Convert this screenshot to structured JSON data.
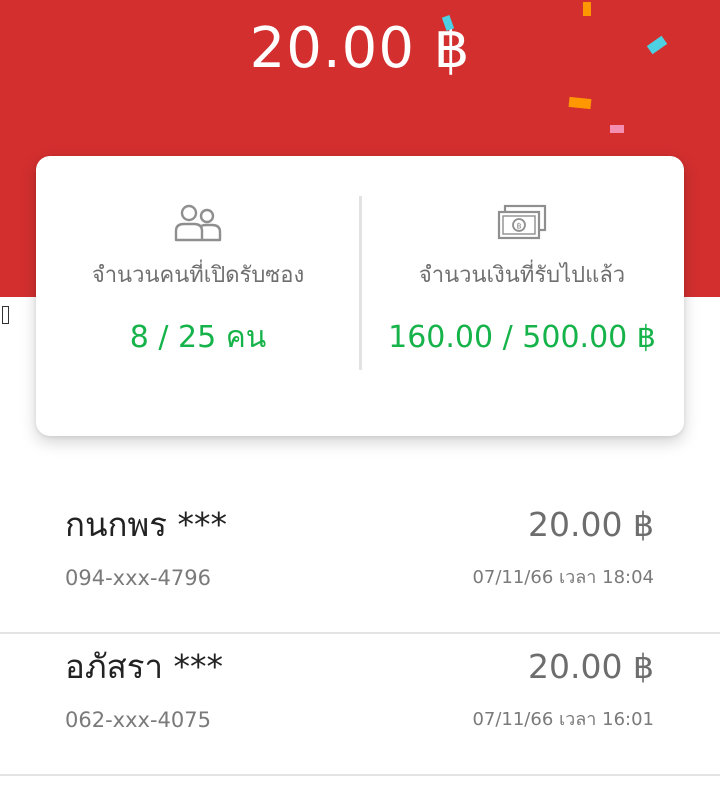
{
  "header": {
    "amount": "20.00 ฿"
  },
  "stats": {
    "opened": {
      "icon": "people-icon",
      "label": "จำนวนคนที่เปิดรับซอง",
      "value": "8 / 25 คน"
    },
    "money": {
      "icon": "banknote-icon",
      "label": "จำนวนเงินที่รับไปแล้ว",
      "value": "160.00 / 500.00 ฿"
    }
  },
  "recipients": [
    {
      "name": "กนกพร ***",
      "amount": "20.00 ฿",
      "phone": "094-xxx-4796",
      "time": "07/11/66 เวลา 18:04"
    },
    {
      "name": "อภัสรา ***",
      "amount": "20.00 ฿",
      "phone": "062-xxx-4075",
      "time": "07/11/66 เวลา 16:01"
    }
  ],
  "colors": {
    "header_red": "#d32f2f",
    "value_green": "#16b34a",
    "confetti": [
      "#4dd0e1",
      "#ff9800",
      "#f48fb1"
    ]
  }
}
